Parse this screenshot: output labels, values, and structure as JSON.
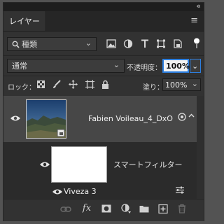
{
  "panel": {
    "collapse_glyph": "«",
    "tab_label": "レイヤー",
    "menu_glyph": "≡"
  },
  "filter": {
    "kind_icon": "search-icon",
    "kind_label": "種類",
    "chevron": "⌄",
    "type_icons": [
      "image-filter-icon",
      "adjustment-filter-icon",
      "type-filter-icon",
      "shape-filter-icon",
      "smart-object-filter-icon"
    ],
    "toggle": "filter-toggle"
  },
  "blend": {
    "mode": "通常",
    "opacity_label": "不透明度：",
    "opacity_value": "100%"
  },
  "lock": {
    "label": "ロック：",
    "icons": [
      "lock-transparent-icon",
      "lock-image-icon",
      "lock-position-icon",
      "lock-artboard-icon",
      "lock-all-icon"
    ],
    "fill_label": "塗り：",
    "fill_value": "100%"
  },
  "layers": [
    {
      "name": "Fabien Voileau_4_DxO",
      "type": "smart-object",
      "visible": true,
      "selected": true
    }
  ],
  "smart_filter": {
    "label": "スマートフィルター",
    "filters": [
      {
        "name": "Viveza 3",
        "visible": true
      }
    ]
  },
  "bottom": {
    "icons": [
      "link-layers-icon",
      "fx-icon",
      "add-mask-icon",
      "new-adjustment-icon",
      "new-group-icon",
      "new-layer-icon",
      "delete-layer-icon"
    ]
  },
  "colors": {
    "panel_bg": "#323232",
    "selected_row": "#474747",
    "focus_ring": "#2d7fe0"
  }
}
